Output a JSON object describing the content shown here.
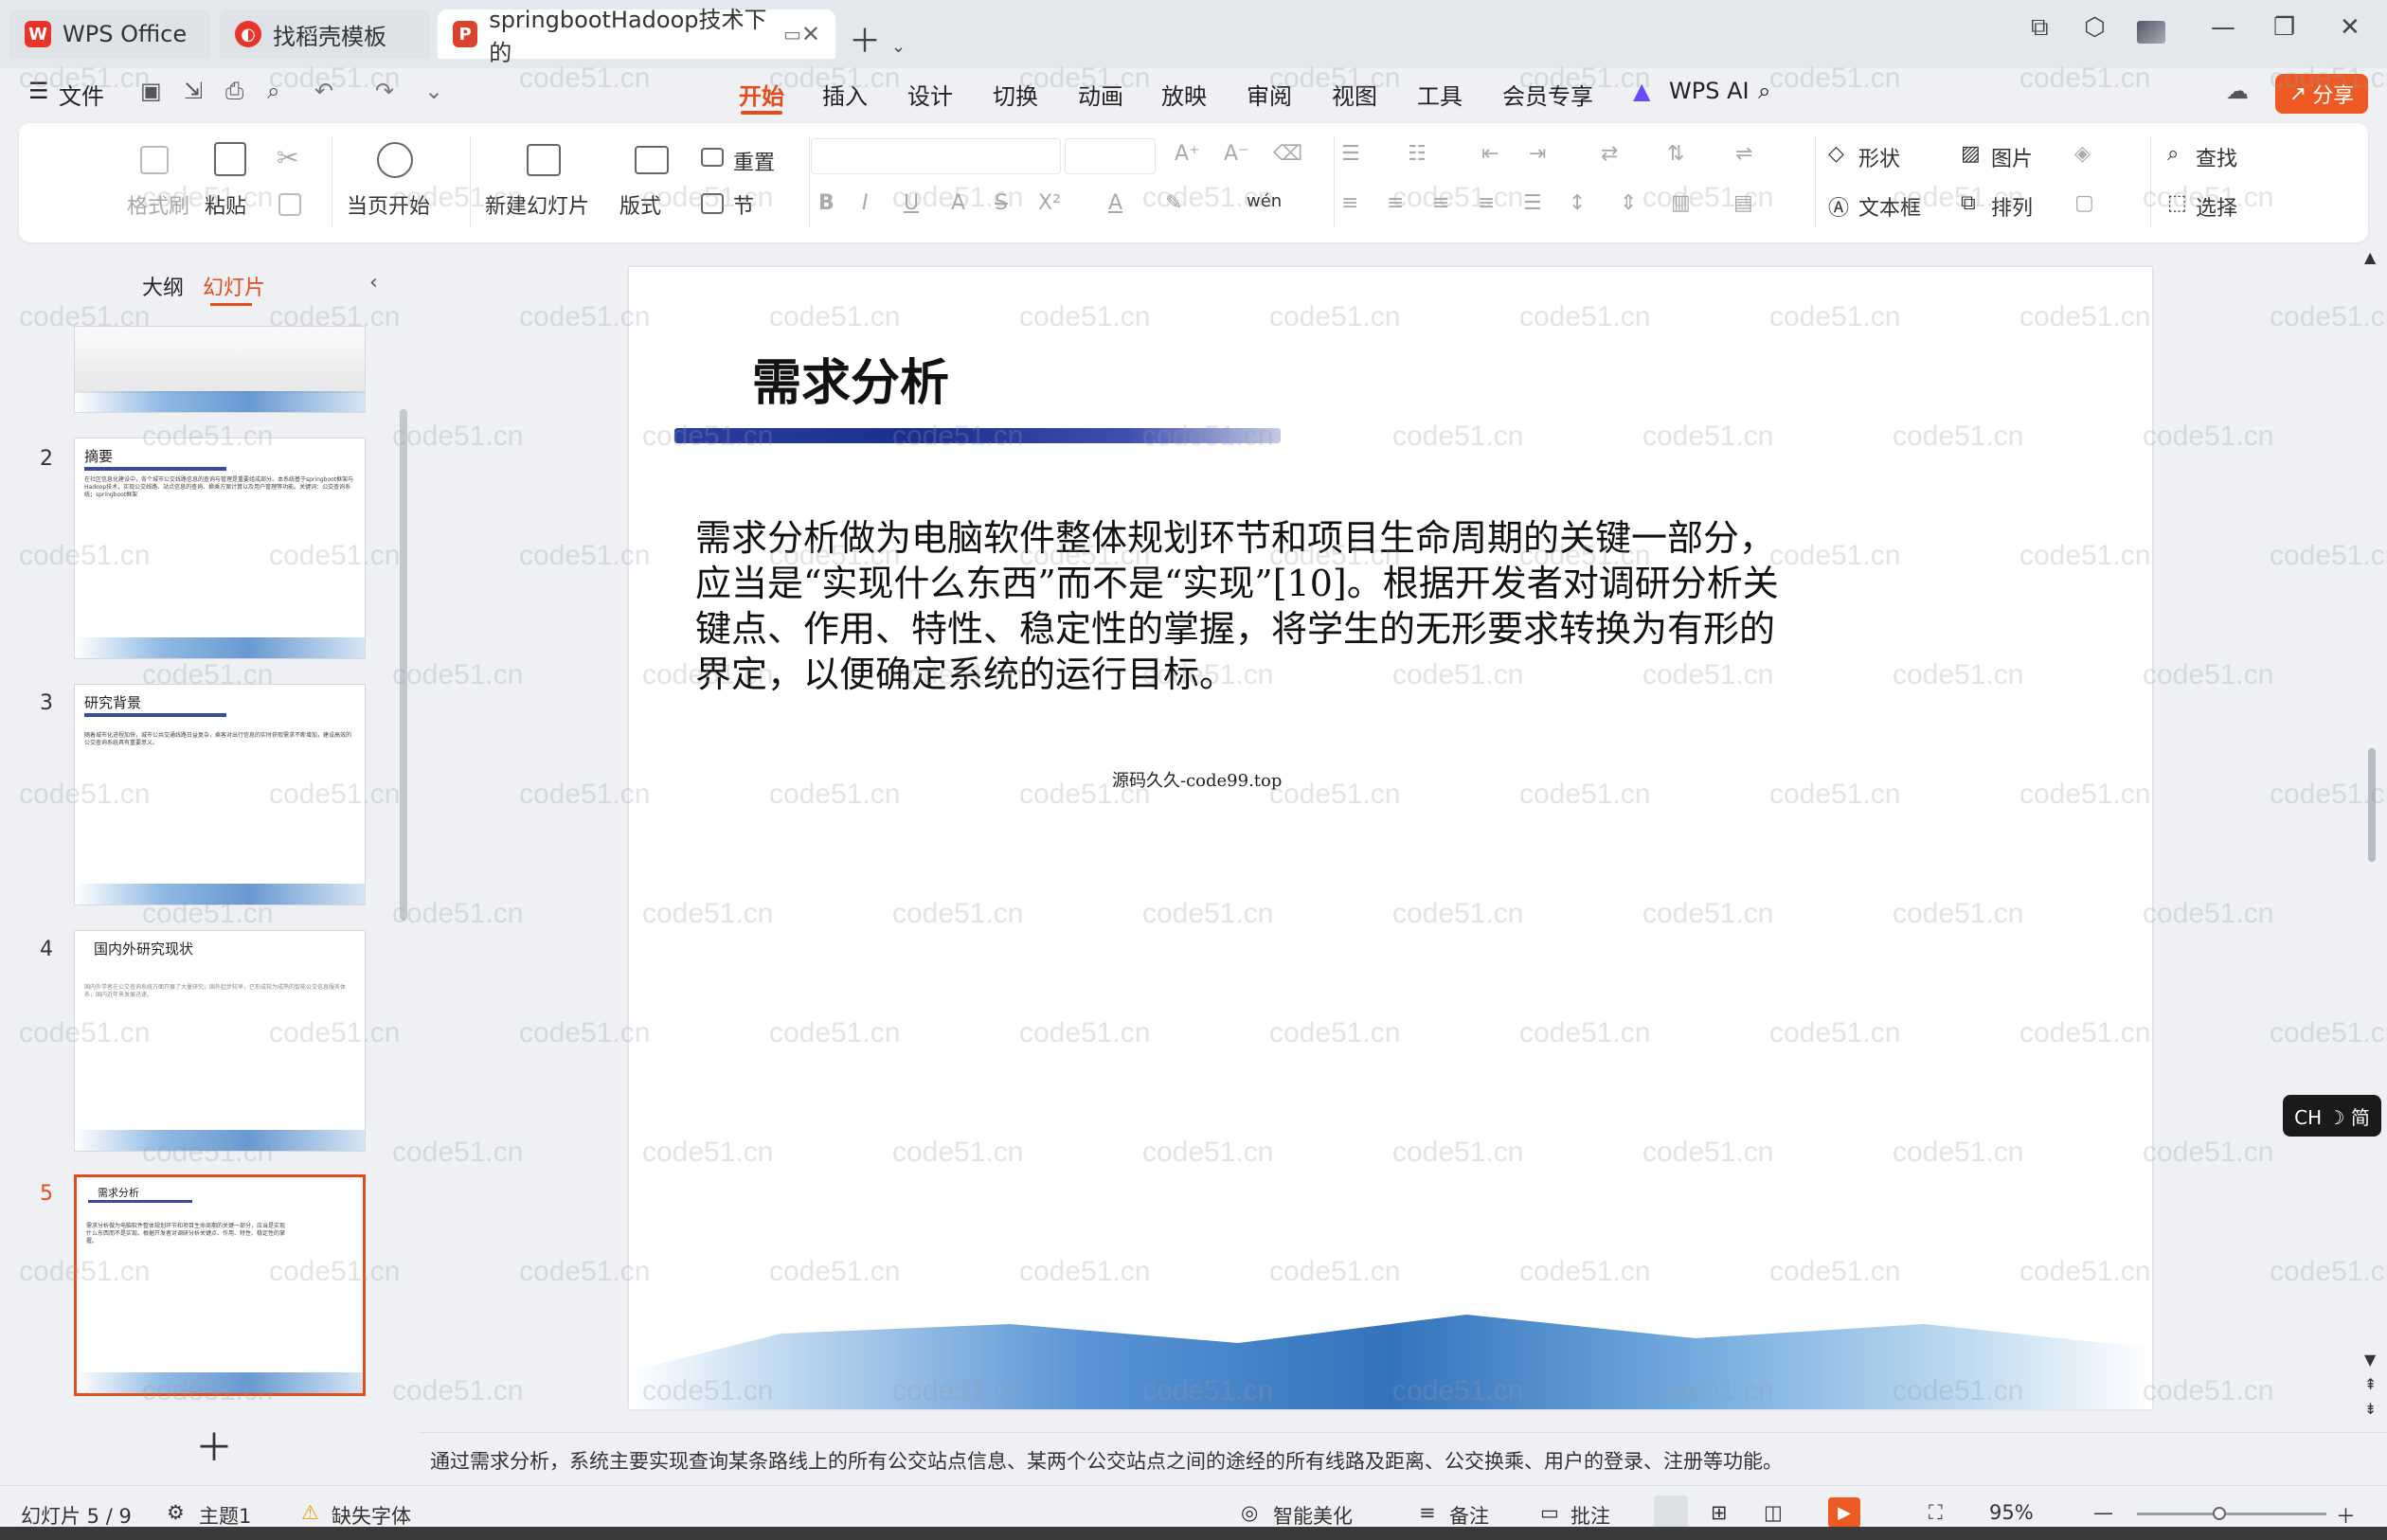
{
  "tabs": {
    "wps": "WPS Office",
    "zdk": "找稻壳模板",
    "doc": "springbootHadoop技术下的"
  },
  "menubar": {
    "file": "文件",
    "items": [
      "开始",
      "插入",
      "设计",
      "切换",
      "动画",
      "放映",
      "审阅",
      "视图",
      "工具",
      "会员专享"
    ],
    "wps_ai": "WPS AI",
    "share": "分享"
  },
  "ribbon": {
    "format_painter": "格式刷",
    "paste": "粘贴",
    "play_from_current": "当页开始",
    "new_slide": "新建幻灯片",
    "layout": "版式",
    "section": "节",
    "reset": "重置",
    "shape": "形状",
    "picture": "图片",
    "find": "查找",
    "textbox": "文本框",
    "arrange": "排列",
    "select": "选择"
  },
  "leftpanel": {
    "tab_outline": "大纲",
    "tab_slides": "幻灯片",
    "thumbnails": [
      {
        "num": "2",
        "title": "摘要",
        "text": "在社区信息化建设中，各个城市公交线路信息的查询与管理是重要组成部分。本系统基于springboot框架与Hadoop技术，实现公交线路、站点信息的查询、换乘方案计算以及用户管理等功能。关键词：公交查询系统；springboot框架"
      },
      {
        "num": "3",
        "title": "研究背景",
        "text": "随着城市化进程加快，城市公共交通线路日益复杂，乘客对出行信息的实时获取需求不断增加，建设高效的公交查询系统具有重要意义。"
      },
      {
        "num": "4",
        "title": "国内外研究现状",
        "text": "国内外学者在公交查询系统方面开展了大量研究，国外起步较早，已形成较为成熟的智能公交信息服务体系，国内近年来发展迅速。"
      },
      {
        "num": "5",
        "title": "需求分析",
        "text": "需求分析做为电脑软件整体规划环节和项目生命周期的关键一部分，应当是实现什么东西而不是实现。根据开发者对调研分析关键点、作用、特性、稳定性的掌握。"
      }
    ]
  },
  "slide": {
    "title": "需求分析",
    "body": "需求分析做为电脑软件整体规划环节和项目生命周期的关键一部分，应当是“实现什么东西”而不是“实现”[10]。根据开发者对调研分析关键点、作用、特性、稳定性的掌握，将学生的无形要求转换为有形的界定，以便确定系统的运行目标。",
    "source": "源码久久-code99.top"
  },
  "notes": "通过需求分析，系统主要实现查询某条路线上的所有公交站点信息、某两个公交站点之间的途经的所有线路及距离、公交换乘、用户的登录、注册等功能。",
  "status": {
    "slide_counter": "幻灯片 5 / 9",
    "theme": "主题1",
    "missing_font": "缺失字体",
    "beautify": "智能美化",
    "notes_btn": "备注",
    "comments_btn": "批注",
    "zoom": "95%"
  },
  "ime": "CH ☽ 简",
  "watermark": "code51.cn",
  "colors": {
    "accent": "#e54c1c",
    "share": "#ee5a24"
  }
}
